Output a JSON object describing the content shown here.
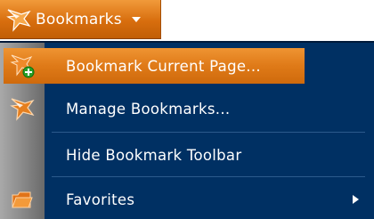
{
  "toolbar": {
    "bookmarks_label": "Bookmarks",
    "icon": "bookmark-star-icon"
  },
  "menu": {
    "items": [
      {
        "label": "Bookmark Current Page...",
        "icon": "add-bookmark-icon",
        "highlighted": true
      },
      {
        "label": "Manage Bookmarks...",
        "icon": "bookmark-star-icon"
      },
      {
        "label": "Hide Bookmark Toolbar"
      },
      {
        "label": "Favorites",
        "icon": "folder-icon",
        "has_submenu": true
      }
    ]
  },
  "colors": {
    "accent_orange": "#df7a18",
    "menu_background": "#003063",
    "gutter_gray": "#8d8d8d"
  }
}
